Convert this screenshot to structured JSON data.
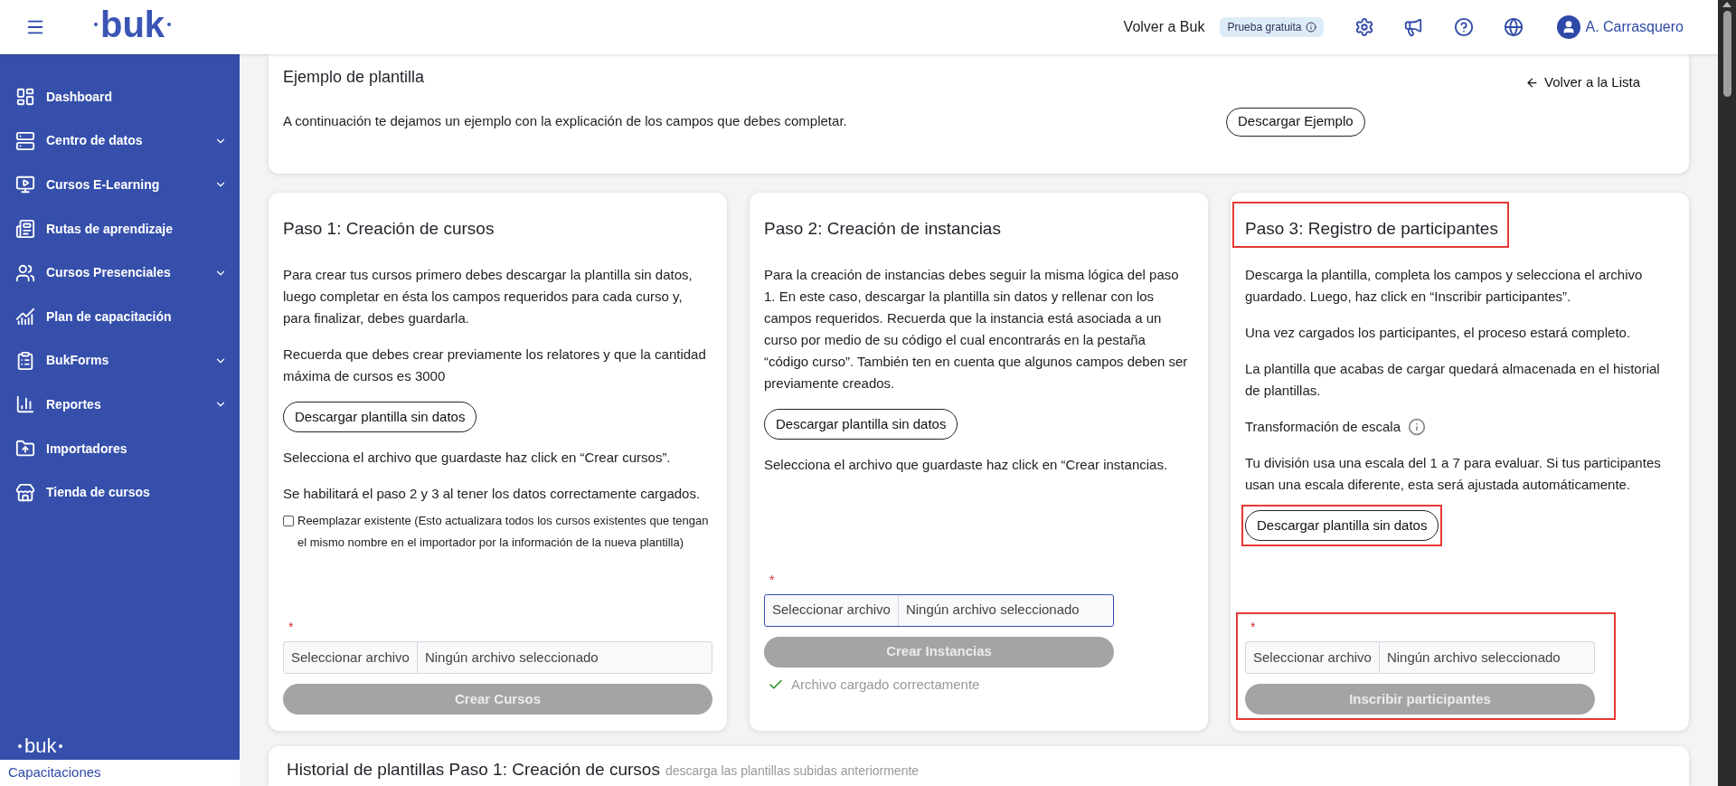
{
  "header": {
    "logo": "buk",
    "back_link": "Volver a Buk",
    "badge": "Prueba gratuita",
    "user_name": "A. Carrasquero"
  },
  "sidebar": {
    "items": [
      {
        "label": "Dashboard",
        "has_submenu": false
      },
      {
        "label": "Centro de datos",
        "has_submenu": true
      },
      {
        "label": "Cursos E-Learning",
        "has_submenu": true
      },
      {
        "label": "Rutas de aprendizaje",
        "has_submenu": false
      },
      {
        "label": "Cursos Presenciales",
        "has_submenu": true
      },
      {
        "label": "Plan de capacitación",
        "has_submenu": false
      },
      {
        "label": "BukForms",
        "has_submenu": true
      },
      {
        "label": "Reportes",
        "has_submenu": true
      },
      {
        "label": "Importadores",
        "has_submenu": false
      },
      {
        "label": "Tienda de cursos",
        "has_submenu": false
      }
    ],
    "footer_logo": "buk",
    "app_name": "Capacitaciones"
  },
  "example": {
    "title": "Ejemplo de plantilla",
    "back_link": "Volver a la Lista",
    "description": "A continuación te dejamos un ejemplo con la explicación de los campos que debes completar.",
    "button": "Descargar Ejemplo"
  },
  "steps": [
    {
      "title": "Paso 1: Creación de cursos",
      "highlighted": false,
      "blocks": [
        {
          "kind": "text",
          "text": "Para crear tus cursos primero debes descargar la plantilla sin datos, luego completar en ésta los campos requeridos para cada curso y, para finalizar, debes guardarla."
        },
        {
          "kind": "text",
          "text": "Recuerda que debes crear previamente los relatores y que la cantidad máxima de cursos es 3000"
        },
        {
          "kind": "button",
          "text": "Descargar plantilla sin datos",
          "highlighted": false
        },
        {
          "kind": "text",
          "text": "Selecciona el archivo que guardaste haz click en “Crear cursos”."
        },
        {
          "kind": "text",
          "text": "Se habilitará el paso 2 y 3 al tener los datos correctamente cargados."
        },
        {
          "kind": "checkbox",
          "text": "Reemplazar existente (Esto actualizara todos los cursos existentes que tengan el mismo nombre en el importador por la información de la nueva plantilla)",
          "checked": false
        }
      ],
      "file": {
        "required_mark": "*",
        "button": "Seleccionar archivo",
        "status": "Ningún archivo seleccionado",
        "focused": false,
        "highlighted": false
      },
      "submit": {
        "label": "Crear Cursos",
        "disabled": true
      }
    },
    {
      "title": "Paso 2: Creación de instancias",
      "highlighted": false,
      "blocks": [
        {
          "kind": "text",
          "text": "Para la creación de instancias debes seguir la misma lógica del paso 1. En este caso, descargar la plantilla sin datos y rellenar con los campos requeridos. Recuerda que la instancia está asociada a un curso por medio de su código el cual encontrarás en la pestaña “código curso”. También ten en cuenta que algunos campos deben ser previamente creados."
        },
        {
          "kind": "button",
          "text": "Descargar plantilla sin datos",
          "highlighted": false
        },
        {
          "kind": "text",
          "text": "Selecciona el archivo que guardaste haz click en “Crear instancias."
        }
      ],
      "file": {
        "required_mark": "*",
        "button": "Seleccionar archivo",
        "status": "Ningún archivo seleccionado",
        "focused": true,
        "highlighted": false
      },
      "submit": {
        "label": "Crear Instancias",
        "disabled": true
      },
      "success": "Archivo cargado correctamente"
    },
    {
      "title": "Paso 3: Registro de participantes",
      "highlighted": true,
      "blocks": [
        {
          "kind": "text",
          "text": "Descarga la plantilla, completa los campos y selecciona el archivo guardado. Luego, haz click en “Inscribir participantes”."
        },
        {
          "kind": "text",
          "text": "Una vez cargados los participantes, el proceso estará completo."
        },
        {
          "kind": "text",
          "text": "La plantilla que acabas de cargar quedará almacenada en el historial de plantillas."
        },
        {
          "kind": "info_label",
          "text": "Transformación de escala"
        },
        {
          "kind": "text",
          "text": "Tu división usa una escala del 1 a 7 para evaluar. Si tus participantes usan una escala diferente, esta será ajustada automáticamente."
        },
        {
          "kind": "button",
          "text": "Descargar plantilla sin datos",
          "highlighted": true
        }
      ],
      "file": {
        "required_mark": "*",
        "button": "Seleccionar archivo",
        "status": "Ningún archivo seleccionado",
        "focused": false,
        "highlighted": true
      },
      "submit": {
        "label": "Inscribir participantes",
        "disabled": true
      }
    }
  ],
  "history": {
    "title": "Historial de plantillas Paso 1: Creación de cursos",
    "subtitle": "descarga las plantillas subidas anteriormente"
  }
}
